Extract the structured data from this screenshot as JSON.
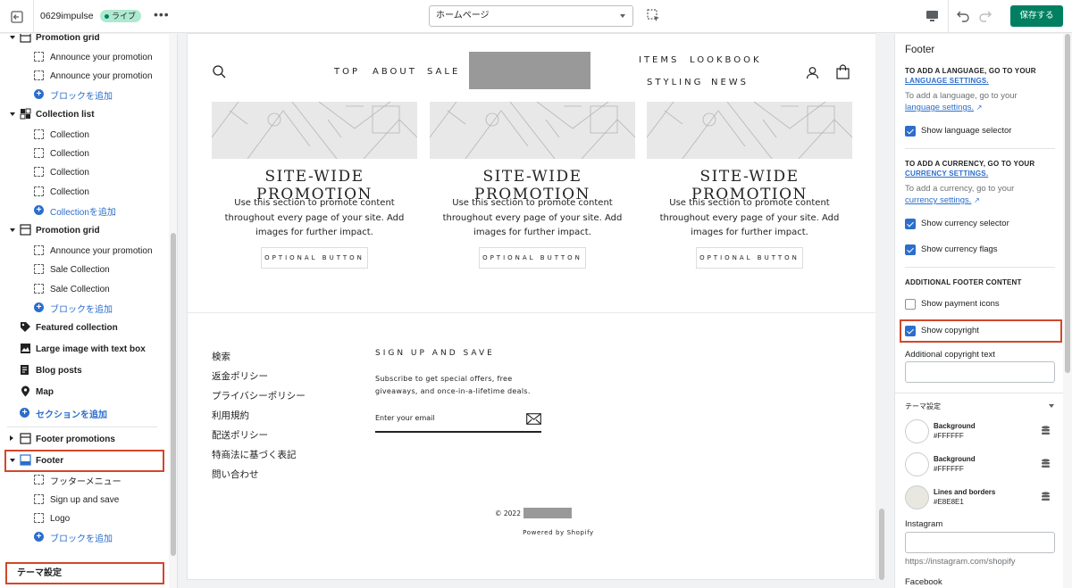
{
  "topbar": {
    "theme_name": "0629impulse",
    "live_badge": "ライブ",
    "page_select": "ホームページ",
    "save_label": "保存する"
  },
  "sidebar": {
    "sections": [
      {
        "kind": "section",
        "label": "Promotion grid",
        "expanded": true,
        "icon": "grid-icon"
      },
      {
        "kind": "block",
        "label": "Announce your promotion"
      },
      {
        "kind": "block",
        "label": "Announce your promotion"
      },
      {
        "kind": "add",
        "label": "ブロックを追加"
      },
      {
        "kind": "section",
        "label": "Collection list",
        "expanded": true,
        "icon": "collection-icon"
      },
      {
        "kind": "block",
        "label": "Collection"
      },
      {
        "kind": "block",
        "label": "Collection"
      },
      {
        "kind": "block",
        "label": "Collection"
      },
      {
        "kind": "block",
        "label": "Collection"
      },
      {
        "kind": "add",
        "label": "Collectionを追加"
      },
      {
        "kind": "section",
        "label": "Promotion grid",
        "expanded": true,
        "icon": "grid-icon"
      },
      {
        "kind": "block",
        "label": "Announce your promotion"
      },
      {
        "kind": "block",
        "label": "Sale Collection"
      },
      {
        "kind": "block",
        "label": "Sale Collection"
      },
      {
        "kind": "add",
        "label": "ブロックを追加"
      },
      {
        "kind": "section",
        "label": "Featured collection",
        "icon": "tag-icon"
      },
      {
        "kind": "section",
        "label": "Large image with text box",
        "icon": "image-icon"
      },
      {
        "kind": "section",
        "label": "Blog posts",
        "icon": "blog-icon"
      },
      {
        "kind": "section",
        "label": "Map",
        "icon": "map-pin-icon"
      },
      {
        "kind": "add-section",
        "label": "セクションを追加"
      },
      {
        "kind": "section",
        "label": "Footer promotions",
        "expanded": false,
        "icon": "grid-icon"
      },
      {
        "kind": "section",
        "label": "Footer",
        "expanded": true,
        "icon": "footer-icon"
      },
      {
        "kind": "block",
        "label": "フッターメニュー"
      },
      {
        "kind": "block",
        "label": "Sign up and save"
      },
      {
        "kind": "block",
        "label": "Logo"
      },
      {
        "kind": "add",
        "label": "ブロックを追加"
      }
    ],
    "theme_settings": "テーマ設定"
  },
  "preview": {
    "nav_left": [
      "TOP",
      "ABOUT",
      "SALE"
    ],
    "nav_right_top": [
      "ITEMS",
      "LOOKBOOK"
    ],
    "nav_right_bottom": [
      "STYLING",
      "NEWS"
    ],
    "promos": [
      {
        "title": "SITE-WIDE PROMOTION",
        "text": "Use this section to promote content throughout every page of your site. Add images for further impact.",
        "button": "OPTIONAL BUTTON"
      },
      {
        "title": "SITE-WIDE PROMOTION",
        "text": "Use this section to promote content throughout every page of your site. Add images for further impact.",
        "button": "OPTIONAL BUTTON"
      },
      {
        "title": "SITE-WIDE PROMOTION",
        "text": "Use this section to promote content throughout every page of your site. Add images for further impact.",
        "button": "OPTIONAL BUTTON"
      }
    ],
    "footer_menu": [
      "検索",
      "返金ポリシー",
      "プライバシーポリシー",
      "利用規約",
      "配送ポリシー",
      "特商法に基づく表記",
      "問い合わせ"
    ],
    "signup_title": "SIGN UP AND SAVE",
    "signup_text": "Subscribe to get special offers, free giveaways, and once-in-a-lifetime deals.",
    "signup_placeholder": "Enter your email",
    "copyright": "© 2022",
    "powered": "Powered by Shopify"
  },
  "panel": {
    "title": "Footer",
    "lang_heading": "TO ADD A LANGUAGE, GO TO YOUR",
    "lang_heading_link": "LANGUAGE SETTINGS.",
    "lang_text": "To add a language, go to your",
    "lang_link": "language settings.",
    "show_language_selector": "Show language selector",
    "currency_heading": "TO ADD A CURRENCY, GO TO YOUR",
    "currency_heading_link": "CURRENCY SETTINGS.",
    "currency_text": "To add a currency, go to your",
    "currency_link": "currency settings.",
    "show_currency_selector": "Show currency selector",
    "show_currency_flags": "Show currency flags",
    "additional_heading": "ADDITIONAL FOOTER CONTENT",
    "show_payment_icons": "Show payment icons",
    "show_copyright": "Show copyright",
    "additional_copyright_label": "Additional copyright text",
    "theme_settings_head": "テーマ設定",
    "swatches": [
      {
        "name": "Background",
        "value": "#FFFFFF",
        "color": "#FFFFFF"
      },
      {
        "name": "Background",
        "value": "#FFFFFF",
        "color": "#FFFFFF"
      },
      {
        "name": "Lines and borders",
        "value": "#E8E8E1",
        "color": "#E8E8E1"
      }
    ],
    "instagram_label": "Instagram",
    "instagram_help": "https://instagram.com/shopify",
    "facebook_label": "Facebook"
  }
}
